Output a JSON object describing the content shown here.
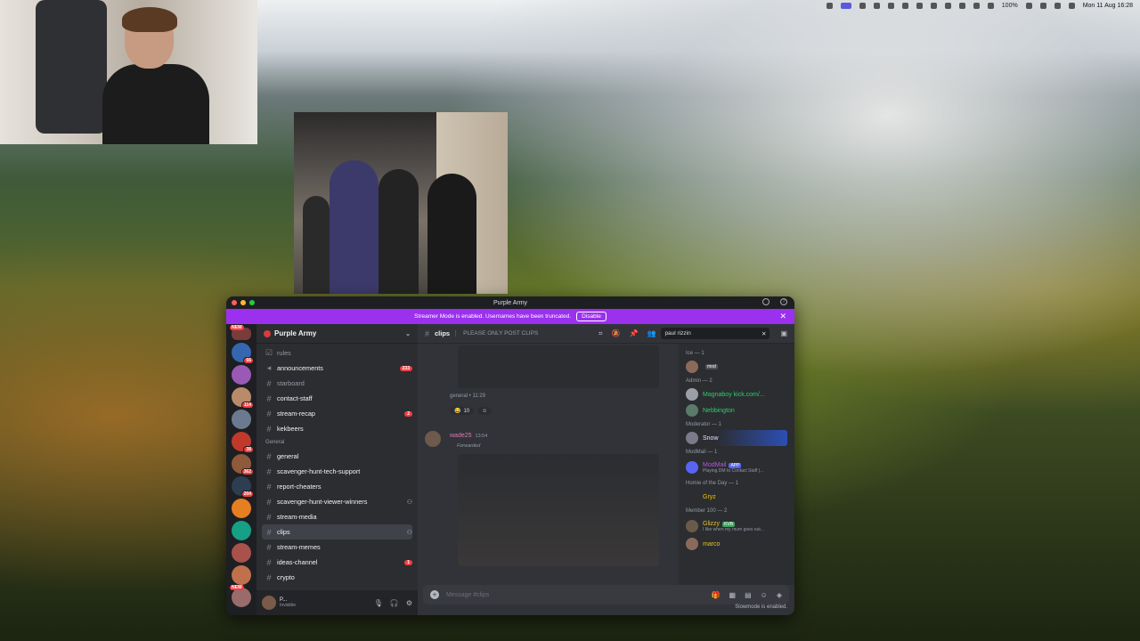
{
  "menubar": {
    "clock": "Mon 11 Aug 16:28",
    "battery": "100%"
  },
  "window": {
    "title": "Purple Army"
  },
  "banner": {
    "text": "Streamer Mode is enabled. Usernames have been truncated.",
    "button": "Disable"
  },
  "servers": [
    {
      "tag": "NEW",
      "badge": ""
    },
    {
      "tag": "",
      "badge": "66"
    },
    {
      "tag": "",
      "badge": ""
    },
    {
      "tag": "",
      "badge": "114"
    },
    {
      "tag": "",
      "badge": ""
    },
    {
      "tag": "",
      "badge": "38"
    },
    {
      "tag": "",
      "badge": "362"
    },
    {
      "tag": "",
      "badge": "204"
    },
    {
      "tag": "",
      "badge": ""
    },
    {
      "tag": "",
      "badge": ""
    },
    {
      "tag": "",
      "badge": ""
    },
    {
      "tag": "",
      "badge": ""
    },
    {
      "tag": "NEW",
      "badge": ""
    }
  ],
  "guild": {
    "name": "Purple Army"
  },
  "channels": {
    "rules": "rules",
    "announcements": "announcements",
    "announcements_badge": "233",
    "starboard": "starboard",
    "contact_staff": "contact-staff",
    "stream_recap": "stream-recap",
    "stream_recap_badge": "2",
    "kekbeers": "kekbeers",
    "category_general": "General",
    "general": "general",
    "scavenger_support": "scavenger-hunt-tech-support",
    "report_cheaters": "report-cheaters",
    "scavenger_winners": "scavenger-hunt-viewer-winners",
    "stream_media": "stream-media",
    "clips": "clips",
    "stream_memes": "stream-memes",
    "ideas": "ideas-channel",
    "ideas_badge": "1",
    "crypto": "crypto"
  },
  "user": {
    "name": "P...",
    "status": "Invisible"
  },
  "chat": {
    "channel": "clips",
    "topic": "PLEASE ONLY POST CLIPS",
    "search": "paul rizzin",
    "ref_meta": "general • 11:29",
    "reaction_count": "10",
    "author": "wade25",
    "time": "13:54",
    "forwarded": "Forwarded",
    "placeholder": "Message #clips",
    "slowmode": "Slowmode is enabled."
  },
  "members": {
    "groups": [
      {
        "label": "Ice — 1"
      },
      {
        "label": "Admin — 2"
      },
      {
        "label": "Moderator — 1"
      },
      {
        "label": "ModMail — 1"
      },
      {
        "label": "Homie of the Day — 1"
      },
      {
        "label": "Member 100 — 2"
      }
    ],
    "magnaboy": "Magnaboy kick.com/...",
    "nebbington": "Nebbington",
    "snow": "Snow",
    "modmail": "ModMail",
    "modmail_tag": "APP",
    "modmail_status": "Playing DM to Contact Staff |...",
    "gryz": "Gryz",
    "glizzy": "Glizzy",
    "glizzy_tag": "KVB",
    "glizzy_status": "I like when my mum goes out...",
    "marco": "marco"
  },
  "colors": {
    "banner": "#9b30ef",
    "accent": "#5865f2",
    "badge": "#f23f43"
  }
}
